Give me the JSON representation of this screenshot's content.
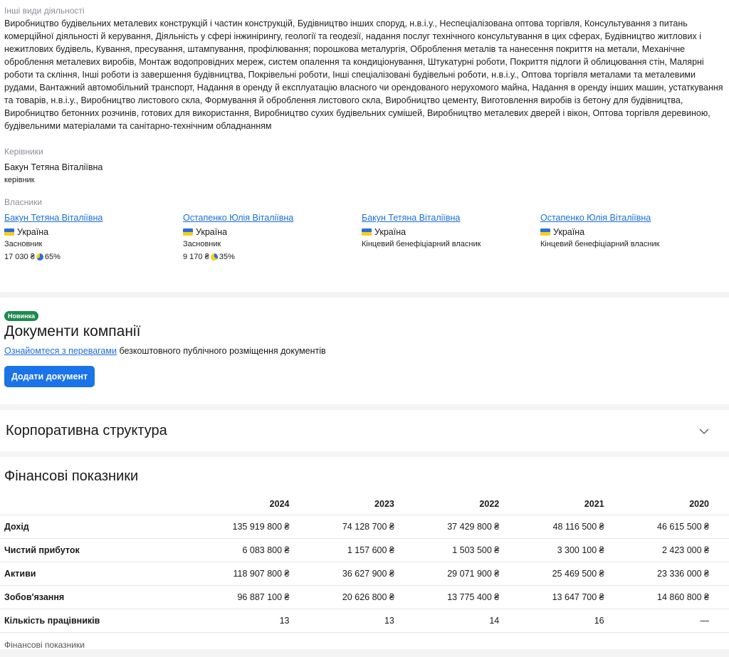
{
  "activities": {
    "label": "Інші види діяльності",
    "text": "Виробництво будівельних металевих конструкцій і частин конструкцій, Будівництво інших споруд, н.в.і.у., Неспеціалізована оптова торгівля, Консультування з питань комерційної діяльності й керування, Діяльність у сфері інжинірингу, геології та геодезії, надання послуг технічного консультування в цих сферах, Будівництво житлових і нежитлових будівель, Кування, пресування, штампування, профілювання; порошкова металургія, Оброблення металів та нанесення покриття на метали, Механічне оброблення металевих виробів, Монтаж водопровідних мереж, систем опалення та кондиціонування, Штукатурні роботи, Покриття підлоги й облицювання стін, Малярні роботи та скління, Інші роботи із завершення будівництва, Покрівельні роботи, Інші спеціалізовані будівельні роботи, н.в.і.у., Оптова торгівля металами та металевими рудами, Вантажний автомобільний транспорт, Надання в оренду й експлуатацію власного чи орендованого нерухомого майна, Надання в оренду інших машин, устаткування та товарів, н.в.і.у., Виробництво листового скла, Формування й оброблення листового скла, Виробництво цементу, Виготовлення виробів із бетону для будівництва, Виробництво бетонних розчинів, готових для використання, Виробництво сухих будівельних сумішей, Виробництво металевих дверей і вікон, Оптова торгівля деревиною, будівельними матеріалами та санітарно-технічним обладнанням"
  },
  "managers": {
    "label": "Керівники",
    "name": "Бакун Тетяна Віталіївна",
    "role": "керівник"
  },
  "owners": {
    "label": "Власники",
    "items": [
      {
        "name": "Бакун Тетяна Віталіївна",
        "country": "Україна",
        "role": "Засновник",
        "amount": "17 030 ₴",
        "percent": "65%",
        "share": 0.65
      },
      {
        "name": "Остапенко Юлія Віталіївна",
        "country": "Україна",
        "role": "Засновник",
        "amount": "9 170 ₴",
        "percent": "35%",
        "share": 0.35
      },
      {
        "name": "Бакун Тетяна Віталіївна",
        "country": "Україна",
        "role": "Кінцевий бенефіціарний власник"
      },
      {
        "name": "Остапенко Юлія Віталіївна",
        "country": "Україна",
        "role": "Кінцевий бенефіціарний власник"
      }
    ]
  },
  "docs": {
    "badge": "Новинка",
    "title": "Документи компанії",
    "link": "Ознайомтеся з перевагами",
    "text": " безкоштовного публічного розміщення документів",
    "button": "Додати документ"
  },
  "corp": {
    "title": "Корпоративна структура"
  },
  "fin": {
    "title": "Фінансові показники",
    "years": [
      "2024",
      "2023",
      "2022",
      "2021",
      "2020"
    ],
    "rows": [
      {
        "label": "Дохід",
        "values": [
          "135 919 800 ₴",
          "74 128 700 ₴",
          "37 429 800 ₴",
          "48 116 500 ₴",
          "46 615 500 ₴"
        ]
      },
      {
        "label": "Чистий прибуток",
        "values": [
          "6 083 800 ₴",
          "1 157 600 ₴",
          "1 503 500 ₴",
          "3 300 100 ₴",
          "2 423 000 ₴"
        ]
      },
      {
        "label": "Активи",
        "values": [
          "118 907 800 ₴",
          "36 627 900 ₴",
          "29 071 900 ₴",
          "25 469 500 ₴",
          "23 336 000 ₴"
        ]
      },
      {
        "label": "Зобов'язання",
        "values": [
          "96 887 100 ₴",
          "20 626 800 ₴",
          "13 775 400 ₴",
          "13 647 700 ₴",
          "14 860 800 ₴"
        ]
      },
      {
        "label": "Кількість працівників",
        "values": [
          "13",
          "13",
          "14",
          "16",
          "—"
        ]
      }
    ],
    "footer": "Фінансові показники"
  },
  "colors": {
    "link": "#1a6fd8",
    "button": "#1a73e8",
    "badge": "#1e8a4d",
    "pie_main": "#2a6fd6",
    "pie_rest": "#f5cf1a"
  }
}
